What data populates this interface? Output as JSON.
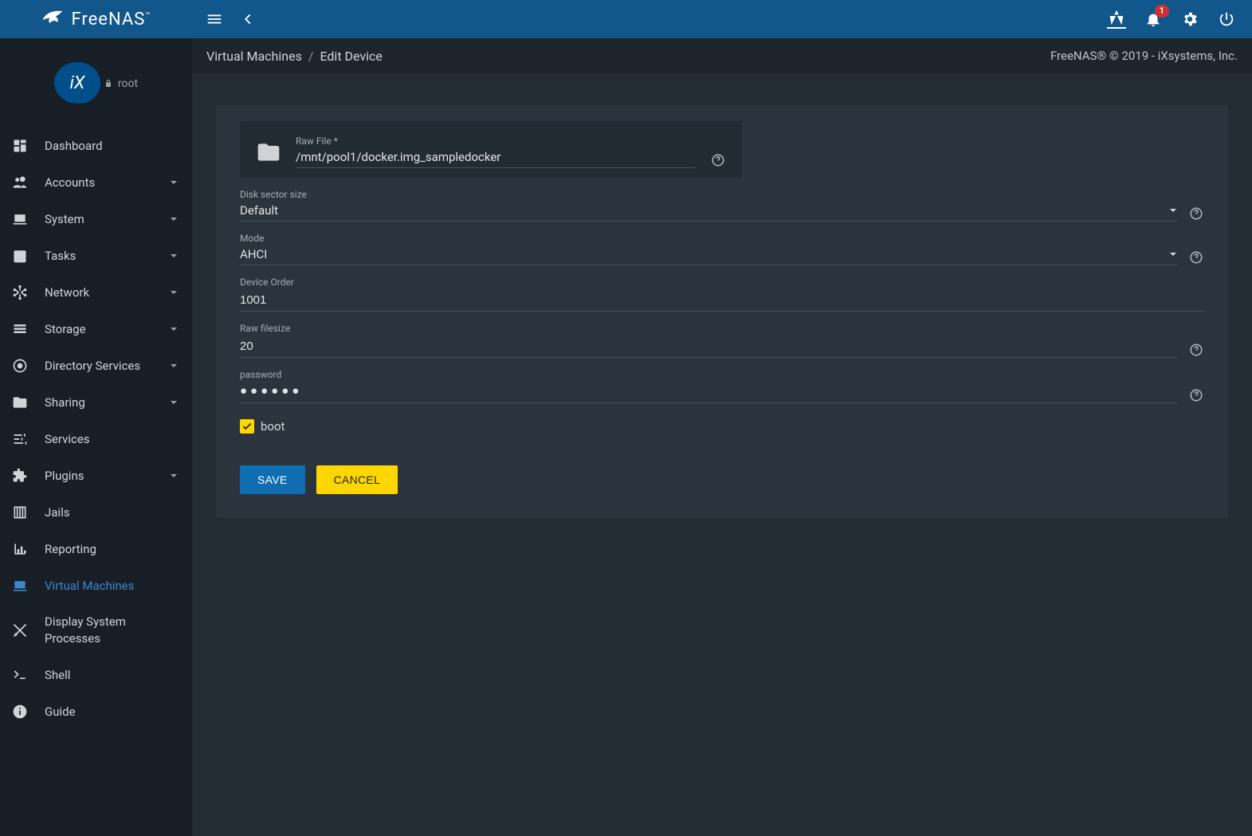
{
  "app": {
    "name": "FreeNAS",
    "trademark": "™",
    "user": "root",
    "copyright": "FreeNAS® © 2019 - iXsystems, Inc.",
    "notif_count": "1"
  },
  "breadcrumb": {
    "root": "Virtual Machines",
    "page": "Edit Device"
  },
  "sidebar": {
    "items": [
      {
        "label": "Dashboard",
        "expandable": false,
        "icon": "dashboard"
      },
      {
        "label": "Accounts",
        "expandable": true,
        "icon": "people"
      },
      {
        "label": "System",
        "expandable": true,
        "icon": "laptop"
      },
      {
        "label": "Tasks",
        "expandable": true,
        "icon": "calendar"
      },
      {
        "label": "Network",
        "expandable": true,
        "icon": "network"
      },
      {
        "label": "Storage",
        "expandable": true,
        "icon": "storage"
      },
      {
        "label": "Directory Services",
        "expandable": true,
        "icon": "target"
      },
      {
        "label": "Sharing",
        "expandable": true,
        "icon": "folder-share"
      },
      {
        "label": "Services",
        "expandable": false,
        "icon": "tune"
      },
      {
        "label": "Plugins",
        "expandable": true,
        "icon": "extension"
      },
      {
        "label": "Jails",
        "expandable": false,
        "icon": "jail"
      },
      {
        "label": "Reporting",
        "expandable": false,
        "icon": "chart"
      },
      {
        "label": "Virtual Machines",
        "expandable": false,
        "icon": "laptop",
        "active": true
      },
      {
        "label": "Display System Processes",
        "expandable": false,
        "icon": "process"
      },
      {
        "label": "Shell",
        "expandable": false,
        "icon": "terminal"
      },
      {
        "label": "Guide",
        "expandable": false,
        "icon": "info"
      }
    ]
  },
  "form": {
    "raw_file_label": "Raw File *",
    "raw_file_value": "/mnt/pool1/docker.img_sampledocker",
    "disk_sector_label": "Disk sector size",
    "disk_sector_value": "Default",
    "mode_label": "Mode",
    "mode_value": "AHCI",
    "device_order_label": "Device Order",
    "device_order_value": "1001",
    "raw_filesize_label": "Raw filesize",
    "raw_filesize_value": "20",
    "password_label": "password",
    "password_masked": "●●●●●●",
    "boot_label": "boot",
    "boot_checked": true,
    "save_label": "SAVE",
    "cancel_label": "CANCEL"
  }
}
